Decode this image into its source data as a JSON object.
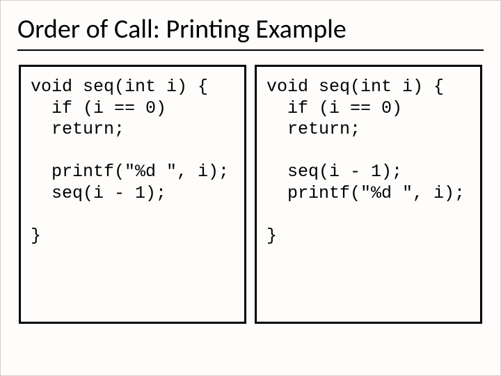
{
  "slide": {
    "title": "Order of Call: Printing Example",
    "left_code": "void seq(int i) {\n  if (i == 0)\n  return;\n\n  printf(\"%d \", i);\n  seq(i - 1);\n\n}",
    "right_code": "void seq(int i) {\n  if (i == 0)\n  return;\n\n  seq(i - 1);\n  printf(\"%d \", i);\n\n}"
  }
}
